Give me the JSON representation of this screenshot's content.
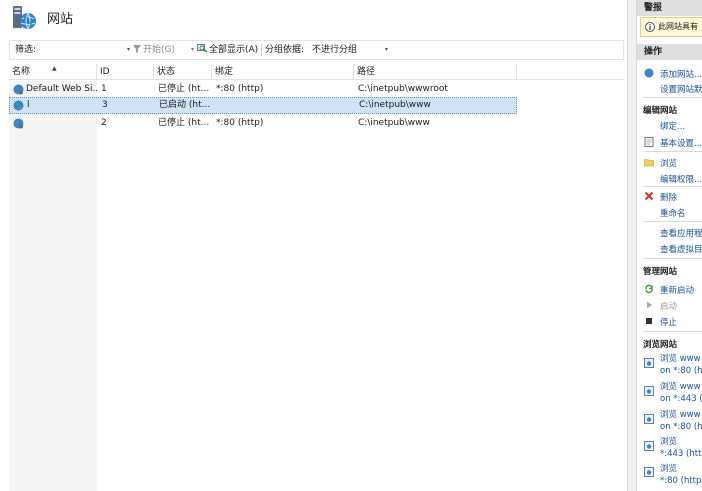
{
  "header": {
    "title": "网站"
  },
  "toolbar": {
    "filter_label": "筛选:",
    "dropdown_glyph": "▾",
    "start_label": "开始(G)",
    "show_all_label": "全部显示(A)",
    "group_by_label": "分组依据:",
    "group_by_value": "不进行分组"
  },
  "table": {
    "columns": [
      "名称",
      "ID",
      "状态",
      "绑定",
      "路径"
    ],
    "sort_glyph": "▲",
    "rows": [
      {
        "name": "Default Web Si...",
        "id": "1",
        "status": "已停止 (ht...",
        "binding": "*:80 (http)",
        "path": "C:\\inetpub\\wwwroot"
      },
      {
        "name": "l",
        "id": "3",
        "status": "已启动 (ht...",
        "binding": "",
        "path": "C:\\inetpub\\www",
        "selected": true
      },
      {
        "name": "",
        "id": "2",
        "status": "已停止 (ht...",
        "binding": "*:80 (http)",
        "path": "C:\\inetpub\\www"
      }
    ]
  },
  "actions": {
    "alert_header": "警报",
    "alert_text": "此网站具有",
    "actions_header": "操作",
    "items": {
      "add_site": "添加网站...",
      "set_defaults": "设置网站默",
      "edit_site": "编辑网站",
      "bindings": "绑定...",
      "basic_settings": "基本设置...",
      "browse": "浏览",
      "edit_permissions": "编辑权限...",
      "delete": "删除",
      "rename": "重命名",
      "view_apps": "查看应用程",
      "view_vdirs": "查看虚拟目",
      "manage_site": "管理网站",
      "restart": "重新启动",
      "start": "启动",
      "stop": "停止",
      "browse_site": "浏览网站"
    },
    "browse_links": [
      {
        "line1": "浏览 www",
        "line2": "on *:80 (h"
      },
      {
        "line1": "浏览 www",
        "line2": "on *:443 ("
      },
      {
        "line1": "浏览 www",
        "line2": "on *:80 (h"
      },
      {
        "line1": "浏览",
        "line2": "*:443 (http"
      },
      {
        "line1": "浏览",
        "line2": "*:80 (http)"
      }
    ]
  },
  "colors": {
    "selection": "#cfe3f7",
    "link": "#1a4f9c",
    "section_header": "#dedede",
    "alert_bg": "#fff9d8",
    "delete_red": "#d9322b"
  }
}
